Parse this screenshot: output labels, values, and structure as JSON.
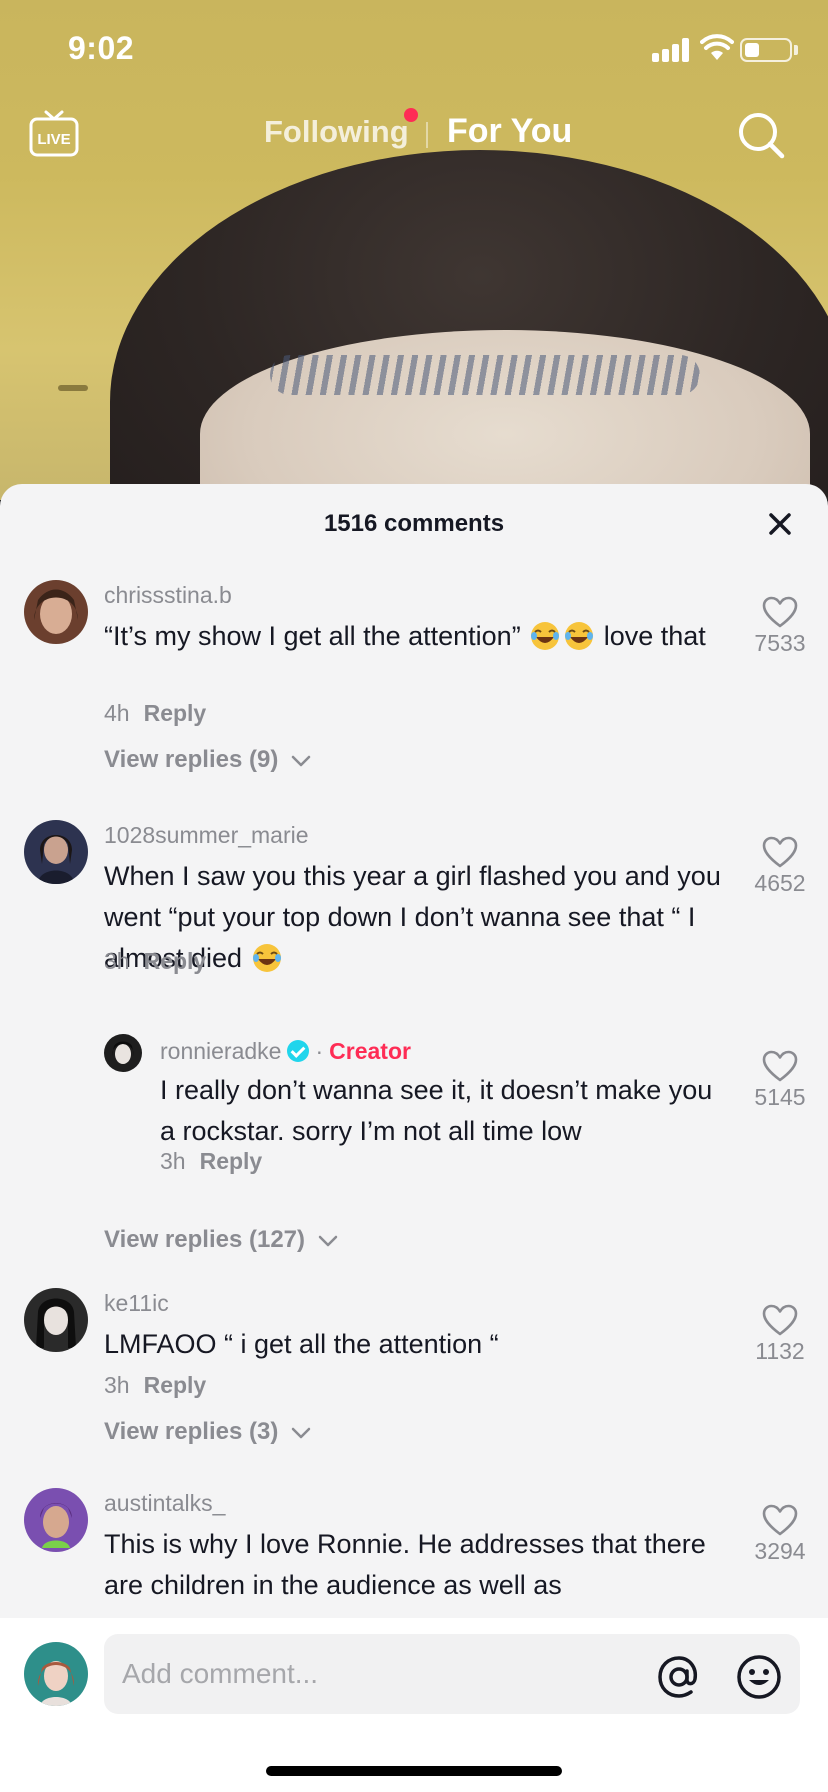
{
  "status_bar": {
    "time": "9:02"
  },
  "top_nav": {
    "live_label": "LIVE",
    "following": "Following",
    "for_you": "For You"
  },
  "sheet": {
    "title": "1516 comments"
  },
  "comments": [
    {
      "username": "chrissstina.b",
      "text_before_emoji": "“It’s my show I get all the attention”",
      "text_after_emoji": " love that",
      "time": "4h",
      "reply": "Reply",
      "likes": "7533",
      "view_replies": "View replies (9)"
    },
    {
      "username": "1028summer_marie",
      "text_before_emoji": "When I saw you this year a girl flashed you and you went “put your top down I don’t wanna see that “ I almost died",
      "time": "3h",
      "reply": "Reply",
      "likes": "4652",
      "view_replies": "View replies (127)"
    },
    {
      "username": "ke11ic",
      "text": "LMFAOO “ i get all the attention “",
      "time": "3h",
      "reply": "Reply",
      "likes": "1132",
      "view_replies": "View replies (3)"
    },
    {
      "username": "austintalks_",
      "text": "This is why I love Ronnie. He addresses that there are children in the audience as well as",
      "likes": "3294"
    }
  ],
  "creator_reply": {
    "username": "ronnieradke",
    "badge": "Creator",
    "separator": "·",
    "text": "I really don’t wanna see it, it doesn’t make you a rockstar. sorry I’m not all time low",
    "time": "3h",
    "reply": "Reply",
    "likes": "5145"
  },
  "input": {
    "placeholder": "Add comment..."
  },
  "colors": {
    "accent": "#fe2c55",
    "verified": "#20d5ec",
    "muted_text": "#8a8b91",
    "sheet_bg": "#f4f4f5"
  }
}
